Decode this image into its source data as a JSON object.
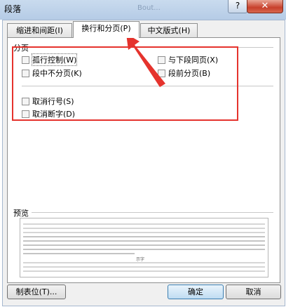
{
  "window": {
    "title": "段落",
    "ghost_title": "Bout...",
    "help_label": "?",
    "close_label": "✕"
  },
  "tabs": [
    {
      "label": "缩进和间距(I)"
    },
    {
      "label": "换行和分页(P)"
    },
    {
      "label": "中文版式(H)"
    }
  ],
  "pagination": {
    "section_label": "分页",
    "options": [
      {
        "label": "孤行控制(W)",
        "checked": false
      },
      {
        "label": "与下段同页(X)",
        "checked": false
      },
      {
        "label": "段中不分页(K)",
        "checked": false
      },
      {
        "label": "段前分页(B)",
        "checked": false
      }
    ],
    "options2": [
      {
        "label": "取消行号(S)",
        "checked": false
      },
      {
        "label": "取消断字(D)",
        "checked": false
      }
    ]
  },
  "preview": {
    "section_label": "预览",
    "sample_text": "示字"
  },
  "buttons": {
    "tabs_label": "制表位(T)...",
    "ok_label": "确定",
    "cancel_label": "取消"
  },
  "colors": {
    "annotation": "#e5332d",
    "titlebar": "#c9dbee"
  },
  "icons": [
    "checkbox-icon",
    "annotation-arrow-icon"
  ]
}
